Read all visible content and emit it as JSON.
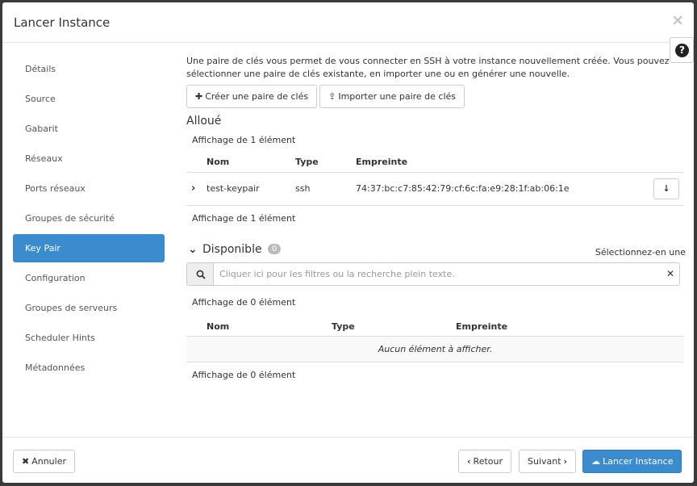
{
  "modal": {
    "title": "Lancer Instance",
    "close_glyph": "×",
    "help_glyph": "?"
  },
  "sidebar": {
    "items": [
      {
        "label": "Détails"
      },
      {
        "label": "Source"
      },
      {
        "label": "Gabarit"
      },
      {
        "label": "Réseaux"
      },
      {
        "label": "Ports réseaux"
      },
      {
        "label": "Groupes de sécurité"
      },
      {
        "label": "Key Pair"
      },
      {
        "label": "Configuration"
      },
      {
        "label": "Groupes de serveurs"
      },
      {
        "label": "Scheduler Hints"
      },
      {
        "label": "Métadonnées"
      }
    ],
    "active_index": 6
  },
  "main": {
    "intro_line1": "Une paire de clés vous permet de vous connecter en SSH à votre instance nouvellement créée. Vous pouvez",
    "intro_line2": "sélectionner une paire de clés existante, en importer une ou en générer une nouvelle.",
    "create_keypair_label": "Créer une paire de clés",
    "import_keypair_label": "Importer une paire de clés",
    "allocated": {
      "title": "Alloué",
      "count_top": "Affichage de 1 élément",
      "count_bottom": "Affichage de 1 élément",
      "columns": [
        "Nom",
        "Type",
        "Empreinte"
      ],
      "rows": [
        {
          "name": "test-keypair",
          "type": "ssh",
          "fingerprint": "74:37:bc:c7:85:42:79:cf:6c:fa:e9:28:1f:ab:06:1e"
        }
      ]
    },
    "available": {
      "title": "Disponible",
      "badge": "0",
      "select_hint": "Sélectionnez-en une",
      "search_placeholder": "Cliquer ici pour les filtres ou la recherche plein texte.",
      "count_top": "Affichage de 0 élément",
      "count_bottom": "Affichage de 0 élément",
      "columns": [
        "Nom",
        "Type",
        "Empreinte"
      ],
      "empty_message": "Aucun élément à afficher."
    }
  },
  "footer": {
    "cancel_label": "Annuler",
    "back_label": "Retour",
    "next_label": "Suivant",
    "launch_label": "Lancer Instance"
  },
  "colors": {
    "accent": "#3b8bcf",
    "badge": "#bbbbbb"
  }
}
